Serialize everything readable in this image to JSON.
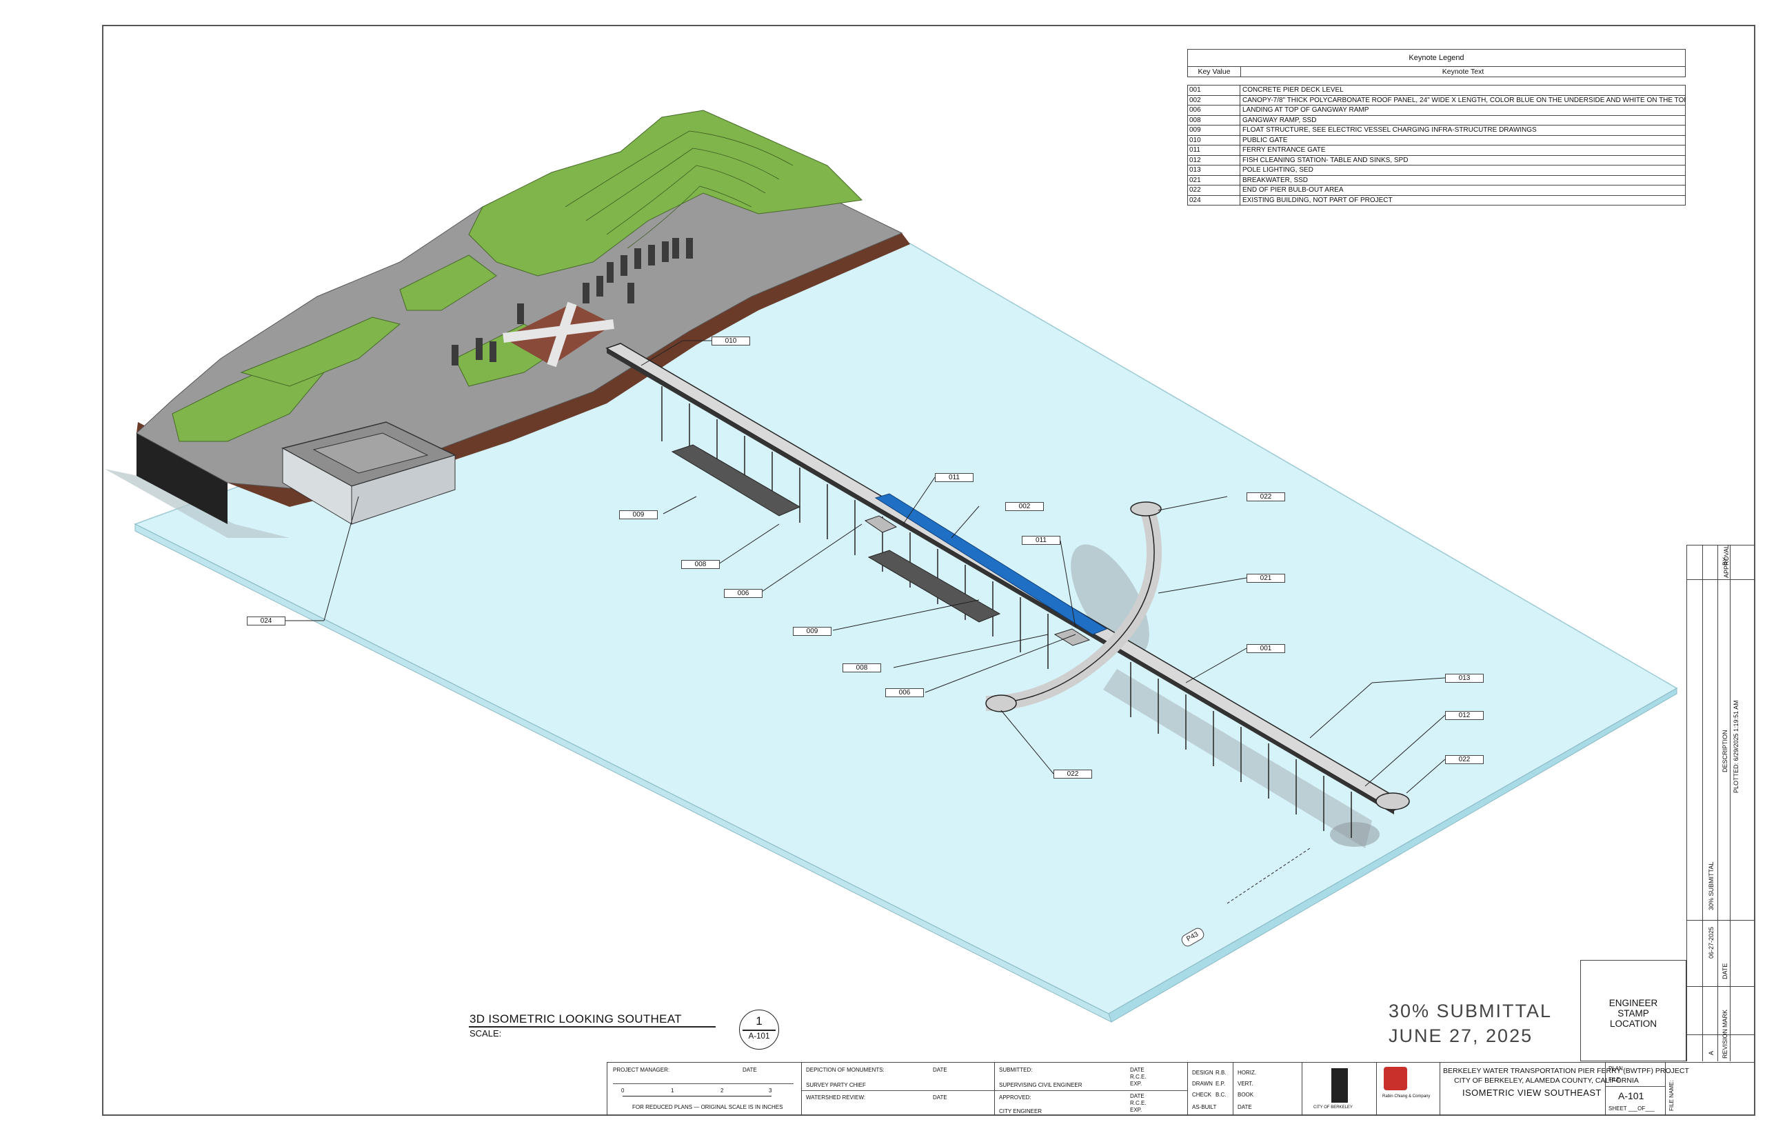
{
  "legend": {
    "title": "Keynote Legend",
    "col_key": "Key Value",
    "col_text": "Keynote Text",
    "rows": [
      {
        "key": "001",
        "text": "CONCRETE PIER DECK LEVEL"
      },
      {
        "key": "002",
        "text": "CANOPY-7/8\" THICK POLYCARBONATE ROOF PANEL, 24\" WIDE X LENGTH, COLOR BLUE ON THE UNDERSIDE AND WHITE ON THE TOP SIDE"
      },
      {
        "key": "006",
        "text": "LANDING AT TOP OF GANGWAY RAMP"
      },
      {
        "key": "008",
        "text": "GANGWAY RAMP, SSD"
      },
      {
        "key": "009",
        "text": "FLOAT STRUCTURE, SEE ELECTRIC VESSEL CHARGING INFRA-STRUCUTRE DRAWINGS"
      },
      {
        "key": "010",
        "text": "PUBLIC GATE"
      },
      {
        "key": "011",
        "text": "FERRY ENTRANCE GATE"
      },
      {
        "key": "012",
        "text": "FISH CLEANING STATION- TABLE AND SINKS, SPD"
      },
      {
        "key": "013",
        "text": "POLE LIGHTING, SED"
      },
      {
        "key": "021",
        "text": "BREAKWATER, SSD"
      },
      {
        "key": "022",
        "text": "END OF PIER BULB-OUT AREA"
      },
      {
        "key": "024",
        "text": "EXISTING BUILDING, NOT PART OF PROJECT"
      }
    ]
  },
  "callouts": {
    "c010": "010",
    "c011a": "011",
    "c002": "002",
    "c022a": "022",
    "c009a": "009",
    "c008a": "008",
    "c006a": "006",
    "c011b": "011",
    "c021": "021",
    "c024": "024",
    "c009b": "009",
    "c001": "001",
    "c008b": "008",
    "c013": "013",
    "c006b": "006",
    "c012": "012",
    "c022b": "022",
    "c022c": "022",
    "p43": "P43"
  },
  "view": {
    "title": "3D ISOMETRIC LOOKING SOUTHEAT",
    "scale_label": "SCALE:",
    "detail_number": "1",
    "sheet_ref": "A-101"
  },
  "submittal": {
    "line1": "30% SUBMITTAL",
    "line2": "JUNE 27, 2025"
  },
  "stamp": {
    "line1": "ENGINEER",
    "line2": "STAMP",
    "line3": "LOCATION"
  },
  "revision": {
    "by": "BY",
    "approval": "APPROVAL",
    "description": "DESCRIPTION",
    "plotted": "PLOTTED: 6/29/2025 1:19:51 AM",
    "submittal_desc": "30% SUBMITTAL",
    "date_value": "06-27-2025",
    "date_label": "DATE",
    "mark_label": "MARK",
    "mark_value": "A",
    "revision_label": "REVISION"
  },
  "titleblock": {
    "project_manager": "PROJECT MANAGER:",
    "date": "DATE",
    "scale_note": "FOR REDUCED PLANS — ORIGINAL SCALE IS IN INCHES",
    "scale_ticks": [
      "0",
      "1",
      "2",
      "3"
    ],
    "depiction": "DEPICTION OF MONUMENTS:",
    "survey_chief": "SURVEY PARTY CHIEF",
    "watershed": "WATERSHED REVIEW:",
    "submitted": "SUBMITTED:",
    "sup_civil": "SUPERVISING CIVIL ENGINEER",
    "approved": "APPROVED:",
    "city_engineer": "CITY ENGINEER",
    "rce": "R.C.E.",
    "exp": "EXP.",
    "design": "DESIGN",
    "design_v": "R.B.",
    "drawn": "DRAWN",
    "drawn_v": "E.P.",
    "check": "CHECK",
    "check_v": "B.C.",
    "as_built": "AS-BUILT",
    "horiz": "HORIZ.",
    "vert": "VERT.",
    "book": "BOOK",
    "date2": "DATE",
    "city_logo_text": "CITY OF BERKELEY",
    "firm_name": "Rabin Chiang & Company",
    "project_line1": "BERKELEY WATER TRANSPORTATION PIER FERRY (BWTPF) PROJECT",
    "project_line2": "CITY OF BERKELEY, ALAMEDA COUNTY, CALIFORNIA",
    "project_line3": "ISOMETRIC VIEW SOUTHEAST",
    "plan": "PLAN",
    "file": "FILE",
    "sheet_number": "A-101",
    "sheet_of": "SHEET ___OF___",
    "file_name_label": "FILE NAME:"
  },
  "colors": {
    "water": "#d7f3fa",
    "water_edge": "#7fc6d6",
    "grass": "#7fb54a",
    "paving": "#9a9a9a",
    "soil": "#6b3b2a",
    "canopy": "#1f6fc4",
    "pier": "#d9d9d9"
  }
}
